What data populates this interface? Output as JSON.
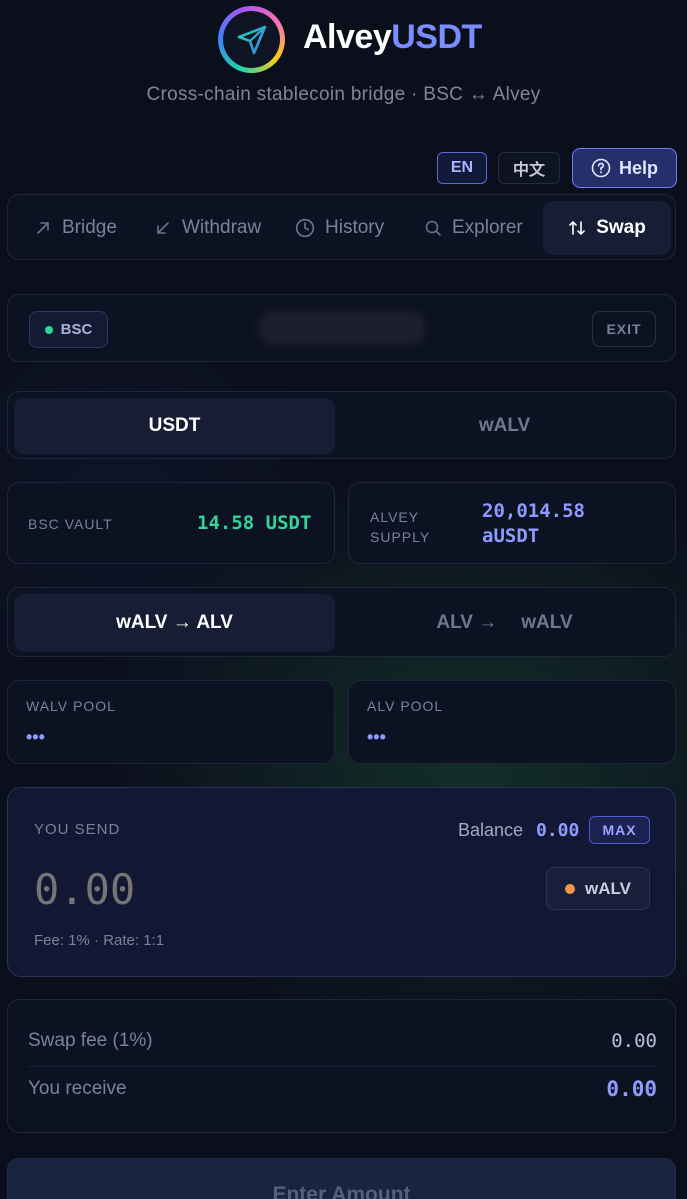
{
  "header": {
    "brand_white": "Alvey",
    "brand_accent": "USDT",
    "tagline": "Cross-chain stablecoin bridge · BSC ↔ Alvey"
  },
  "top_buttons": {
    "en": "EN",
    "zh": "中文",
    "help": "Help"
  },
  "nav": {
    "items": [
      {
        "label": "Bridge",
        "icon": "arrow-up-right-icon"
      },
      {
        "label": "Withdraw",
        "icon": "arrow-down-left-icon"
      },
      {
        "label": "History",
        "icon": "clock-icon"
      },
      {
        "label": "Explorer",
        "icon": "search-icon"
      },
      {
        "label": "Swap",
        "icon": "swap-icon",
        "active": true
      }
    ]
  },
  "account": {
    "chain": "BSC",
    "exit": "EXIT"
  },
  "asset_tabs": {
    "usdt": "USDT",
    "walv": "wALV",
    "selected": "USDT"
  },
  "stats": {
    "bsc_vault_label": "BSC VAULT",
    "bsc_vault_value": "14.58 USDT",
    "alvey_supply_label_1": "ALVEY",
    "alvey_supply_label_2": "SUPPLY",
    "alvey_supply_value_1": "20,014.58",
    "alvey_supply_value_2": "aUSDT"
  },
  "direction_tabs": {
    "walv_to_alv": "wALV → ALV",
    "alv_to": "ALV →",
    "alv_to_target": "wALV",
    "selected": "wALV → ALV"
  },
  "pools": {
    "walv_label": "WALV POOL",
    "walv_value": "•••",
    "alv_label": "ALV POOL",
    "alv_value": "•••"
  },
  "send": {
    "label": "YOU SEND",
    "balance_label": "Balance",
    "balance_value": "0.00",
    "max": "MAX",
    "amount_placeholder": "0.00",
    "token": "wALV",
    "fee_note": "Fee: 1% · Rate: 1:1"
  },
  "summary": {
    "fee_label": "Swap fee (1%)",
    "fee_value": "0.00",
    "receive_label": "You receive",
    "receive_value": "0.00"
  },
  "cta": "Enter Amount",
  "colors": {
    "background": "#0b0f1c",
    "accent": "#7b8cff",
    "green": "#34d399",
    "orange": "#f0974a"
  }
}
